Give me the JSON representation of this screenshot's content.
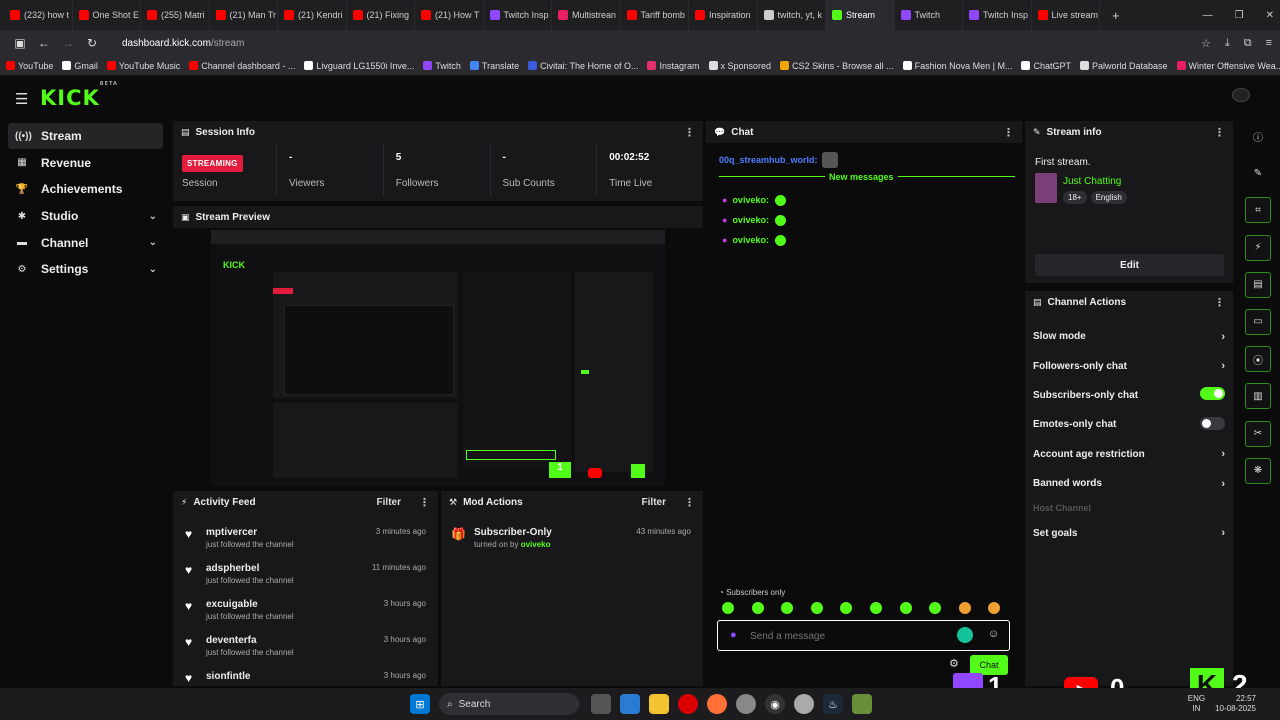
{
  "browser": {
    "tabs": [
      {
        "label": "(232) how t",
        "color": "#ff0000"
      },
      {
        "label": "One Shot E",
        "color": "#ff0000"
      },
      {
        "label": "(255) Matri",
        "color": "#ff0000"
      },
      {
        "label": "(21) Man Tr",
        "color": "#ff0000"
      },
      {
        "label": "(21) Kendri",
        "color": "#ff0000"
      },
      {
        "label": "(21) Fixing",
        "color": "#ff0000"
      },
      {
        "label": "(21) How T",
        "color": "#ff0000"
      },
      {
        "label": "Twitch Insp",
        "color": "#9146ff"
      },
      {
        "label": "Multistrean",
        "color": "#e91e63"
      },
      {
        "label": "Tariff bomb",
        "color": "#ff0000"
      },
      {
        "label": "Inspiration",
        "color": "#ff0000"
      },
      {
        "label": "twitch, yt, k",
        "color": "#cccccc"
      },
      {
        "label": "Stream",
        "color": "#53fc18",
        "active": true
      },
      {
        "label": "Twitch",
        "color": "#9146ff"
      },
      {
        "label": "Twitch Insp",
        "color": "#9146ff"
      },
      {
        "label": "Live stream",
        "color": "#ff0000"
      }
    ],
    "url_host": "dashboard.kick.com",
    "url_path": "/stream",
    "bookmarks": [
      {
        "label": "YouTube",
        "color": "#ff0000"
      },
      {
        "label": "Gmail",
        "color": "#ffffff"
      },
      {
        "label": "YouTube Music",
        "color": "#ff0000"
      },
      {
        "label": "Channel dashboard - ...",
        "color": "#ff0000"
      },
      {
        "label": "Livguard LG1550i Inve...",
        "color": "#ffffff"
      },
      {
        "label": "Twitch",
        "color": "#9146ff"
      },
      {
        "label": "Translate",
        "color": "#4285f4"
      },
      {
        "label": "Civitai: The Home of O...",
        "color": "#3b5bdb"
      },
      {
        "label": "Instagram",
        "color": "#e1306c"
      },
      {
        "label": "x Sponsored",
        "color": "#dddddd"
      },
      {
        "label": "CS2 Skins - Browse all ...",
        "color": "#f0a500"
      },
      {
        "label": "Fashion Nova Men | M...",
        "color": "#ffffff"
      },
      {
        "label": "ChatGPT",
        "color": "#ffffff"
      },
      {
        "label": "Palworld Database",
        "color": "#dddddd"
      },
      {
        "label": "Winter Offensive Wea...",
        "color": "#e91e63"
      }
    ]
  },
  "brand": {
    "logo": "KICK",
    "logo_sup": "BETA",
    "accent": "#53fc18"
  },
  "sidebar": {
    "items": [
      {
        "label": "Stream",
        "icon": "broadcast-icon",
        "glyph": "((•))",
        "active": true,
        "chevron": false
      },
      {
        "label": "Revenue",
        "icon": "revenue-icon",
        "glyph": "▦",
        "chevron": false
      },
      {
        "label": "Achievements",
        "icon": "trophy-icon",
        "glyph": "🏆",
        "chevron": false
      },
      {
        "label": "Studio",
        "icon": "studio-icon",
        "glyph": "✱",
        "chevron": true
      },
      {
        "label": "Channel",
        "icon": "channel-icon",
        "glyph": "▬",
        "chevron": true
      },
      {
        "label": "Settings",
        "icon": "gear-icon",
        "glyph": "⚙",
        "chevron": true
      }
    ]
  },
  "session": {
    "title": "Session Info",
    "status": "STREAMING",
    "status_label": "Session",
    "stats": [
      {
        "value": "-",
        "label": "Viewers"
      },
      {
        "value": "5",
        "label": "Followers"
      },
      {
        "value": "-",
        "label": "Sub Counts"
      },
      {
        "value": "00:02:52",
        "label": "Time Live"
      }
    ]
  },
  "preview": {
    "title": "Stream Preview"
  },
  "activity": {
    "title": "Activity Feed",
    "filter": "Filter",
    "items": [
      {
        "name": "mptivercer",
        "action": "just followed the channel",
        "time": "3 minutes ago"
      },
      {
        "name": "adspherbel",
        "action": "just followed the channel",
        "time": "11 minutes ago"
      },
      {
        "name": "excuigable",
        "action": "just followed the channel",
        "time": "3 hours ago"
      },
      {
        "name": "deventerfa",
        "action": "just followed the channel",
        "time": "3 hours ago"
      },
      {
        "name": "sionfintle",
        "action": "",
        "time": "3 hours ago"
      }
    ]
  },
  "mod": {
    "title": "Mod Actions",
    "filter": "Filter",
    "items": [
      {
        "name": "Subscriber-Only",
        "prefix": "turned on by",
        "by": "oviveko",
        "time": "43 minutes ago"
      }
    ]
  },
  "chat": {
    "title": "Chat",
    "pinned_user": "00q_streamhub_world",
    "new_messages": "New messages",
    "messages": [
      {
        "user": "oviveko:"
      },
      {
        "user": "oviveko:"
      },
      {
        "user": "oviveko:"
      }
    ],
    "mode_label": "Subscribers only",
    "placeholder": "Send a message",
    "send_label": "Chat"
  },
  "streaminfo": {
    "title": "Stream info",
    "stream_title": "First stream.",
    "category": "Just Chatting",
    "tags": [
      "18+",
      "English"
    ],
    "edit_label": "Edit"
  },
  "actions": {
    "title": "Channel Actions",
    "items": [
      {
        "label": "Slow mode",
        "type": "arrow"
      },
      {
        "label": "Followers-only chat",
        "type": "arrow"
      },
      {
        "label": "Subscribers-only chat",
        "type": "toggle",
        "on": true
      },
      {
        "label": "Emotes-only chat",
        "type": "toggle",
        "on": false
      },
      {
        "label": "Account age restriction",
        "type": "arrow"
      },
      {
        "label": "Banned words",
        "type": "arrow"
      },
      {
        "label": "Host Channel",
        "type": "disabled"
      },
      {
        "label": "Set goals",
        "type": "arrow"
      }
    ]
  },
  "rail": [
    "info-icon",
    "pencil-icon",
    "scan-icon",
    "lightning-icon",
    "note-icon",
    "chat-bubble-icon",
    "broadcast-icon",
    "layout-icon",
    "wrench-icon",
    "palette-icon"
  ],
  "overlay": {
    "twitch_count": "1",
    "youtube_count": "0",
    "kick_count": "2"
  },
  "taskbar": {
    "search": "Search",
    "lang1": "ENG",
    "lang2": "IN",
    "time": "22:57",
    "date": "10-08-2025"
  }
}
